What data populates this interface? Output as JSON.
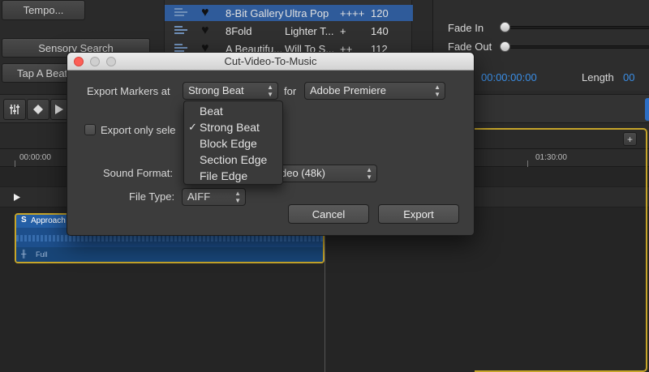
{
  "background_app": {
    "buttons": {
      "tempo": "Tempo...",
      "sensory_search": "Sensory Search",
      "tap_a_beat": "Tap A Beat"
    },
    "tracks": [
      {
        "name": "8-Bit Gallery",
        "genre": "Ultra Pop",
        "intensity": "++++",
        "bpm": "120",
        "selected": true
      },
      {
        "name": "8Fold",
        "genre": "Lighter T...",
        "intensity": "+",
        "bpm": "140",
        "selected": false
      },
      {
        "name": "A Beautifu...",
        "genre": "Will To S...",
        "intensity": "++",
        "bpm": "112",
        "selected": false
      }
    ],
    "right_panel": {
      "fade_in": "Fade In",
      "fade_out": "Fade Out",
      "time_left": "00:00:00:00",
      "length_label": "Length",
      "length_value": "00"
    },
    "timeline": {
      "ruler_start": "00:00:00",
      "ruler_mark": "01:30:00",
      "clip_title": "Approach",
      "clip_footer": "Full",
      "add_button": "+"
    }
  },
  "dialog": {
    "title": "Cut-Video-To-Music",
    "export_markers_label": "Export Markers at",
    "export_markers_value": "Strong Beat",
    "for_label": "for",
    "target_value": "Adobe Premiere",
    "export_only_label": "Export only sele",
    "sound_format_label": "Sound Format:",
    "sound_format_value": "deo (48k)",
    "file_type_label": "File Type:",
    "file_type_value": "AIFF",
    "cancel": "Cancel",
    "export": "Export"
  },
  "marker_menu": {
    "items": [
      "Beat",
      "Strong Beat",
      "Block Edge",
      "Section Edge",
      "File Edge"
    ],
    "checked": "Strong Beat",
    "check_glyph": "✓"
  },
  "colors": {
    "selection_blue": "#2f5b9a",
    "timecode_blue": "#3a8ee6",
    "clip_border": "#c6a52a",
    "clip_fill": "#1d4f8c"
  }
}
